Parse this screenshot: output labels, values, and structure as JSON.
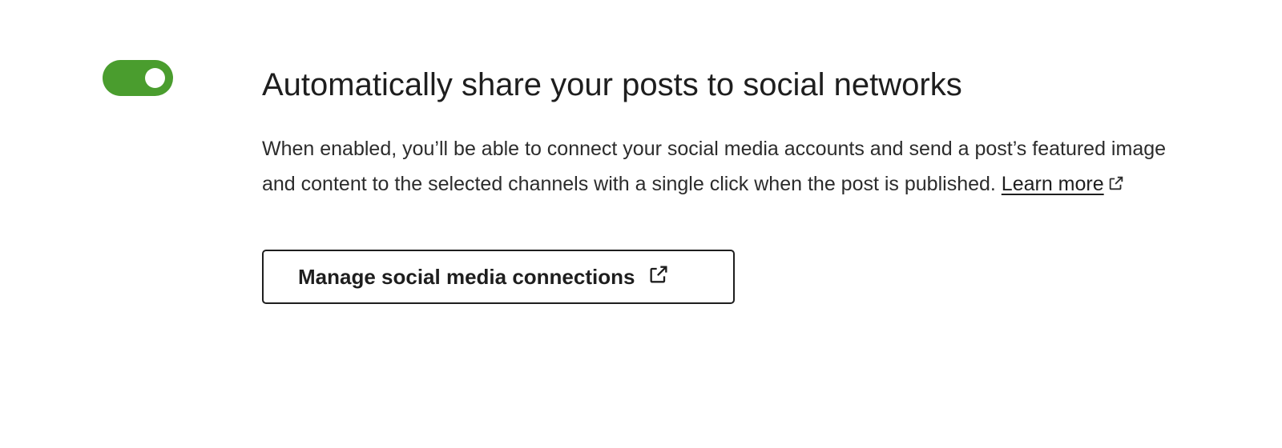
{
  "toggle": {
    "state": "on",
    "color": "#4a9d2e"
  },
  "heading": "Automatically share your posts to social networks",
  "description": {
    "text": "When enabled, you’ll be able to connect your social media accounts and send a post’s featured image and content to the selected channels with a single click when the post is published.",
    "link_label": "Learn more",
    "link_icon": "external-link-icon"
  },
  "button": {
    "label": "Manage social media connections",
    "icon": "external-link-icon"
  }
}
